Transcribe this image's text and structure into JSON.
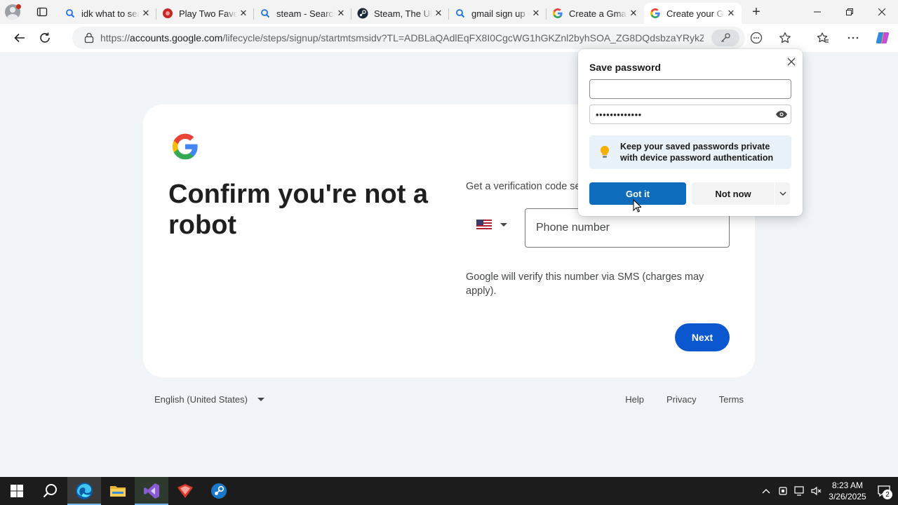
{
  "tabs": [
    {
      "title": "idk what to search",
      "icon": "search-icon"
    },
    {
      "title": "Play Two Favorites",
      "icon": "red-site-icon"
    },
    {
      "title": "steam - Search",
      "icon": "search-icon"
    },
    {
      "title": "Steam, The Ultimate",
      "icon": "steam-icon"
    },
    {
      "title": "gmail sign up - Search",
      "icon": "search-icon"
    },
    {
      "title": "Create a Gmail account",
      "icon": "google-icon"
    },
    {
      "title": "Create your Google Account",
      "icon": "google-icon",
      "active": true
    }
  ],
  "address_bar": {
    "scheme": "https://",
    "host": "accounts.google.com",
    "path": "/lifecycle/steps/signup/startmtsmsidv?TL=ADBLaQAdlEqFX8I0CgcWG1hGKZnl2byhSOA_ZG8DQdsbzaYRykZZ..."
  },
  "page": {
    "headline": "Confirm you're not a robot",
    "subtext": "Get a verification code sent",
    "phone_placeholder": "Phone number",
    "country_flag": "US",
    "sms_note": "Google will verify this number via SMS (charges may apply).",
    "next_label": "Next"
  },
  "footer": {
    "language": "English (United States)",
    "links": [
      "Help",
      "Privacy",
      "Terms"
    ]
  },
  "save_password_popup": {
    "title": "Save password",
    "username_value": "",
    "password_value": "•••••••••••••",
    "tip_text": "Keep your saved passwords private with device password authentication",
    "got_it_label": "Got it",
    "not_now_label": "Not now"
  },
  "taskbar": {
    "time": "8:23 AM",
    "date": "3/26/2025",
    "notification_count": "2"
  },
  "colors": {
    "google_blue": "#0b57d0",
    "edge_blue": "#0f6cbd",
    "page_bg": "#f1f4f9"
  }
}
